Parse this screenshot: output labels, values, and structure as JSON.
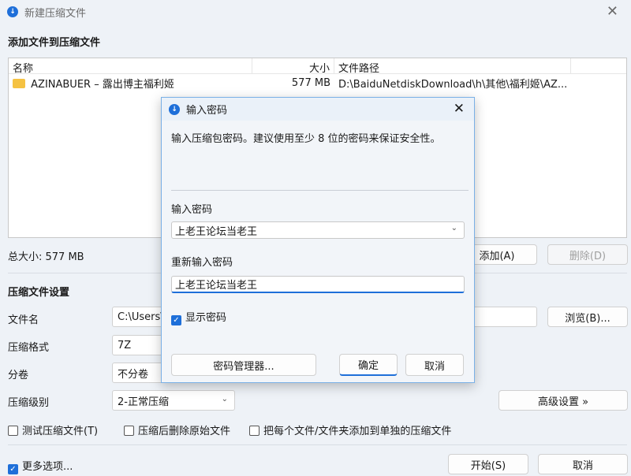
{
  "window": {
    "title": "新建压缩文件",
    "close_icon": "✕"
  },
  "add_section": {
    "title": "添加文件到压缩文件"
  },
  "file_list": {
    "headers": {
      "name": "名称",
      "size": "大小",
      "path": "文件路径"
    },
    "rows": [
      {
        "name": "AZINABUER – 露出博主福利姬",
        "size": "577 MB",
        "path": "D:\\BaiduNetdiskDownload\\h\\其他\\福利姬\\AZ..."
      }
    ]
  },
  "total_size": "总大小: 577 MB",
  "buttons": {
    "add": "添加(A)",
    "delete": "删除(D)",
    "browse": "浏览(B)...",
    "advanced": "高级设置 »",
    "start": "开始(S)",
    "cancel": "取消"
  },
  "settings": {
    "title": "压缩文件设置",
    "filename_label": "文件名",
    "filename_value": "C:\\Users\\",
    "format_label": "压缩格式",
    "format_value": "7Z",
    "split_label": "分卷",
    "split_value": "不分卷",
    "level_label": "压缩级别",
    "level_value": "2-正常压缩"
  },
  "options": {
    "test": "测试压缩文件(T)",
    "delete_after": "压缩后删除原始文件",
    "separate": "把每个文件/文件夹添加到单独的压缩文件",
    "more": "更多选项..."
  },
  "dialog": {
    "title": "输入密码",
    "description": "输入压缩包密码。建议使用至少 8 位的密码来保证安全性。",
    "password_label": "输入密码",
    "password_value": "上老王论坛当老王",
    "confirm_label": "重新输入密码",
    "confirm_value": "上老王论坛当老王",
    "show_password": "显示密码",
    "manager_button": "密码管理器...",
    "ok_button": "确定",
    "cancel_button": "取消"
  },
  "accent_color": "#1e6fd9"
}
